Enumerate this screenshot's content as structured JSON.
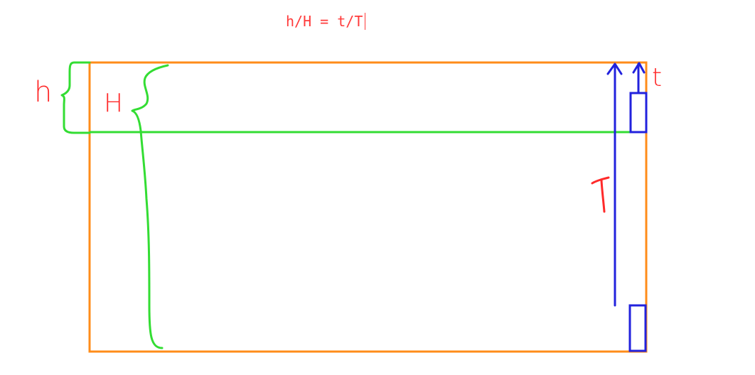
{
  "formula": {
    "text": "h/H = t/T"
  },
  "labels": {
    "h": "h",
    "H": "H",
    "t": "t",
    "T": "T"
  },
  "colors": {
    "frame": "#ff8c1a",
    "brace": "#33dd33",
    "arrow": "#2222dd",
    "text": "#ff2a2a"
  }
}
